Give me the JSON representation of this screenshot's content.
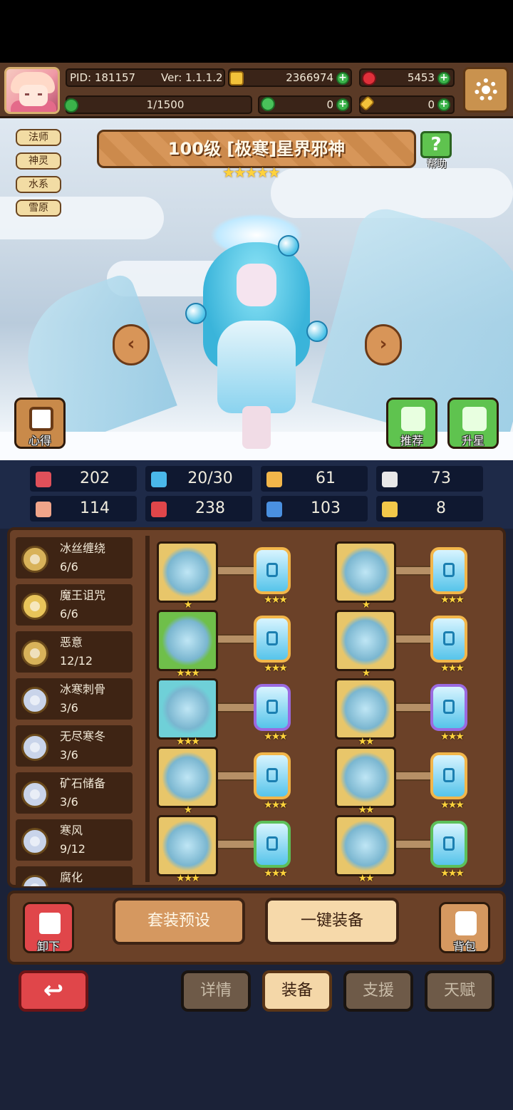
{
  "header": {
    "pid_label": "PID: 181157",
    "version_label": "Ver: 1.1.1.2",
    "gold": "2366974",
    "gems": "5453",
    "stamina": "1/1500",
    "clover": "0",
    "ticket": "0"
  },
  "hero": {
    "title": "100级 [极寒]星界邪神",
    "stars": "★★★★★",
    "tags": [
      "法师",
      "神灵",
      "水系",
      "雪原"
    ],
    "help_label": "帮助",
    "insight_label": "心得",
    "recommend_label": "推荐",
    "upstar_label": "升星",
    "prev_arrow": "‹",
    "next_arrow": "›"
  },
  "stats": [
    {
      "icon": "heart-icon",
      "value": "202",
      "color": "#e0505a"
    },
    {
      "icon": "mana-drop-icon",
      "value": "20/30",
      "color": "#4ab8ea"
    },
    {
      "icon": "shield-icon",
      "value": "61",
      "color": "#f2b64a"
    },
    {
      "icon": "wing-icon",
      "value": "73",
      "color": "#e8e8e8"
    },
    {
      "icon": "fist-icon",
      "value": "114",
      "color": "#f0a58a"
    },
    {
      "icon": "spellbook-icon",
      "value": "238",
      "color": "#e0464a"
    },
    {
      "icon": "scroll-icon",
      "value": "103",
      "color": "#4a90e0"
    },
    {
      "icon": "horseshoe-icon",
      "value": "8",
      "color": "#f2c84a"
    }
  ],
  "sets": [
    {
      "name": "冰丝缠绕",
      "count": "6/6",
      "color": "#d8b25a"
    },
    {
      "name": "魔王诅咒",
      "count": "6/6",
      "color": "#e8c45a"
    },
    {
      "name": "恶意",
      "count": "12/12",
      "color": "#d8b25a"
    },
    {
      "name": "冰寒刺骨",
      "count": "3/6",
      "color": "#c9d4ea"
    },
    {
      "name": "无尽寒冬",
      "count": "3/6",
      "color": "#c9d4ea"
    },
    {
      "name": "矿石储备",
      "count": "3/6",
      "color": "#c9d4ea"
    },
    {
      "name": "寒风",
      "count": "9/12",
      "color": "#c9d4ea"
    },
    {
      "name": "腐化",
      "count": "",
      "color": "#c9d4ea"
    }
  ],
  "equipment": [
    {
      "item": "staff-icon",
      "item_stars": "★",
      "rune_stars": "★★★",
      "rune_border": "#f2b64a",
      "slot_bg": "#e8c66a"
    },
    {
      "item": "horned-helmet-icon",
      "item_stars": "★",
      "rune_stars": "★★★",
      "rune_border": "#f2b64a",
      "slot_bg": "#e8c66a"
    },
    {
      "item": "pouch-icon",
      "item_stars": "★★★",
      "rune_stars": "★★★",
      "rune_border": "#f2b64a",
      "slot_bg": "#6fbf4a"
    },
    {
      "item": "ice-armor-icon",
      "item_stars": "★",
      "rune_stars": "★★★",
      "rune_border": "#f2b64a",
      "slot_bg": "#e8c66a"
    },
    {
      "item": "pendant-icon",
      "item_stars": "★★★",
      "rune_stars": "★★★",
      "rune_border": "#9a6ae0",
      "slot_bg": "#6fd0d8"
    },
    {
      "item": "ice-cloak-icon",
      "item_stars": "★★",
      "rune_stars": "★★★",
      "rune_border": "#9a6ae0",
      "slot_bg": "#e8c66a"
    },
    {
      "item": "ice-crystal-icon",
      "item_stars": "★",
      "rune_stars": "★★★",
      "rune_border": "#f2b64a",
      "slot_bg": "#e8c66a"
    },
    {
      "item": "dark-orb-icon",
      "item_stars": "★★",
      "rune_stars": "★★★",
      "rune_border": "#f2b64a",
      "slot_bg": "#e8c66a"
    },
    {
      "item": "ice-helm-icon",
      "item_stars": "★★★",
      "rune_stars": "★★★",
      "rune_border": "#5cc05a",
      "slot_bg": "#e8c66a"
    },
    {
      "item": "boots-icon",
      "item_stars": "★★",
      "rune_stars": "★★★",
      "rune_border": "#5cc05a",
      "slot_bg": "#e8c66a"
    }
  ],
  "actions": {
    "unequip_label": "卸下",
    "preset_label": "套装预设",
    "equip_all_label": "一键装备",
    "bag_label": "背包"
  },
  "tabs": [
    "详情",
    "装备",
    "支援",
    "天赋"
  ],
  "active_tab": "装备"
}
